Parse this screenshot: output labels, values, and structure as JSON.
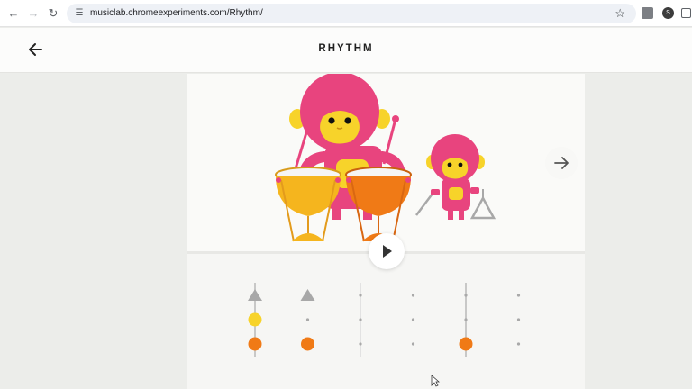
{
  "browser": {
    "url": "musiclab.chromeexperiments.com/Rhythm/",
    "back_icon": "arrow-left-icon",
    "forward_icon": "arrow-right-icon",
    "reload_icon": "reload-icon",
    "bookmark_icon": "star-icon"
  },
  "header": {
    "title": "RHYTHM"
  },
  "colors": {
    "monkey_pink": "#e8447e",
    "monkey_face": "#f7d32a",
    "drum_yellow": "#f5b51e",
    "drum_orange": "#f07a16",
    "triangle_gray": "#a8a8a8"
  },
  "sequencer": {
    "rows": [
      "triangle",
      "small-drum",
      "large-drum"
    ],
    "columns": 6,
    "pattern": [
      [
        true,
        true,
        false,
        false,
        false,
        false
      ],
      [
        true,
        false,
        false,
        false,
        false,
        false
      ],
      [
        true,
        true,
        false,
        false,
        true,
        false
      ]
    ],
    "playhead_columns": [
      0,
      4
    ]
  }
}
